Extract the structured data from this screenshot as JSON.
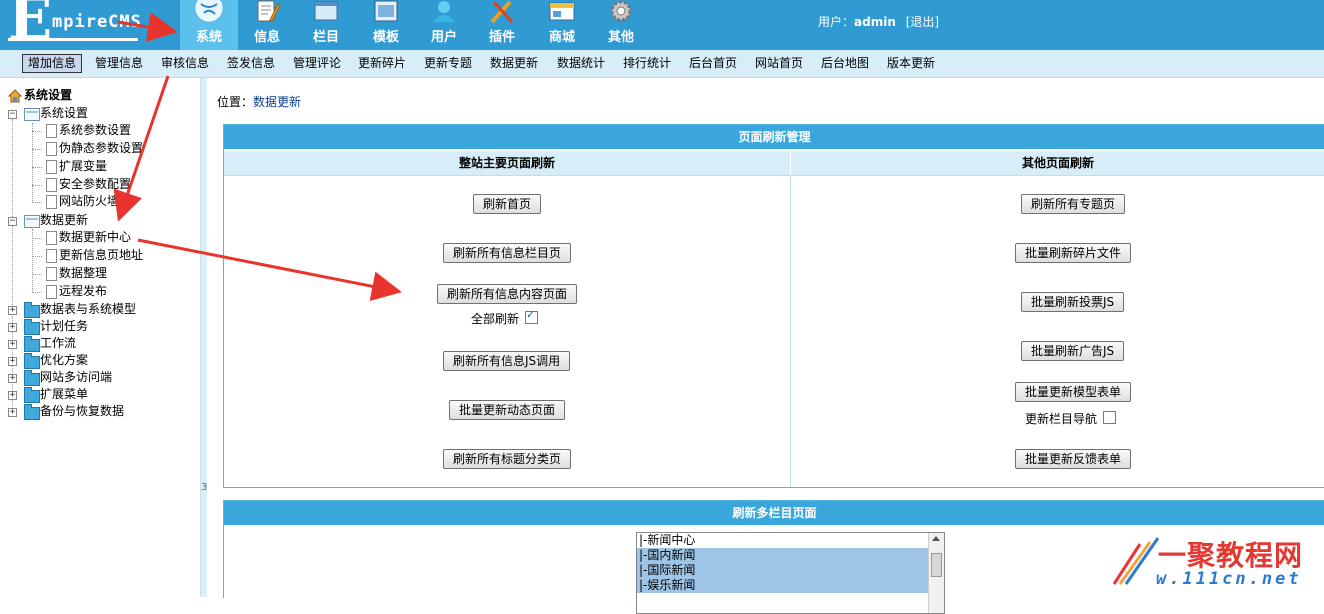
{
  "header": {
    "logo_text": "EmpireCMS",
    "logo_big": "E",
    "logo_rest": "mpireCMS",
    "nav": [
      {
        "label": "系统",
        "icon": "globe-icon",
        "active": true
      },
      {
        "label": "信息",
        "icon": "notepad-icon"
      },
      {
        "label": "栏目",
        "icon": "window-icon"
      },
      {
        "label": "模板",
        "icon": "template-icon"
      },
      {
        "label": "用户",
        "icon": "user-icon"
      },
      {
        "label": "插件",
        "icon": "tools-icon"
      },
      {
        "label": "商城",
        "icon": "store-icon"
      },
      {
        "label": "其他",
        "icon": "gear-icon"
      }
    ],
    "user_label": "用户：",
    "username": "admin",
    "logout": "[退出]"
  },
  "subnav": [
    "增加信息",
    "管理信息",
    "审核信息",
    "签发信息",
    "管理评论",
    "更新碎片",
    "更新专题",
    "数据更新",
    "数据统计",
    "排行统计",
    "后台首页",
    "网站首页",
    "后台地图",
    "版本更新"
  ],
  "sidebar": {
    "root": "系统设置",
    "groups": [
      {
        "label": "系统设置",
        "expanded": true,
        "children": [
          "系统参数设置",
          "伪静态参数设置",
          "扩展变量",
          "安全参数配置",
          "网站防火墙"
        ]
      },
      {
        "label": "数据更新",
        "expanded": true,
        "children": [
          "数据更新中心",
          "更新信息页地址",
          "数据整理",
          "远程发布"
        ]
      },
      {
        "label": "数据表与系统模型"
      },
      {
        "label": "计划任务"
      },
      {
        "label": "工作流"
      },
      {
        "label": "优化方案"
      },
      {
        "label": "网站多访问端"
      },
      {
        "label": "扩展菜单"
      },
      {
        "label": "备份与恢复数据"
      }
    ],
    "divider_mark": "3"
  },
  "main": {
    "location_label": "位置：",
    "location_link": "数据更新",
    "refresh_panel": {
      "title": "页面刷新管理",
      "left_head": "整站主要页面刷新",
      "right_head": "其他页面刷新",
      "left_buttons": [
        "刷新首页",
        "刷新所有信息栏目页",
        "刷新所有信息内容页面",
        "刷新所有信息JS调用",
        "批量更新动态页面",
        "刷新所有标题分类页"
      ],
      "left_checkbox": {
        "label": "全部刷新",
        "checked": true
      },
      "right_buttons": [
        "刷新所有专题页",
        "批量刷新碎片文件",
        "批量刷新投票JS",
        "批量刷新广告JS",
        "批量更新模型表单",
        "批量更新反馈表单"
      ],
      "right_checkbox": {
        "label": "更新栏目导航",
        "checked": false
      }
    },
    "multi_panel": {
      "title": "刷新多栏目页面",
      "options": [
        "|-新闻中心",
        "|-国内新闻",
        "|-国际新闻",
        "|-娱乐新闻"
      ]
    }
  },
  "watermark": {
    "text": "一聚教程网",
    "url": "www.111cn.net",
    "url_visible": "w.111cn.net"
  },
  "colors": {
    "header": "#2f9bd2",
    "panel_title": "#3aa7dc",
    "panel_head": "#d7eef9",
    "arrow": "#e8342c"
  }
}
